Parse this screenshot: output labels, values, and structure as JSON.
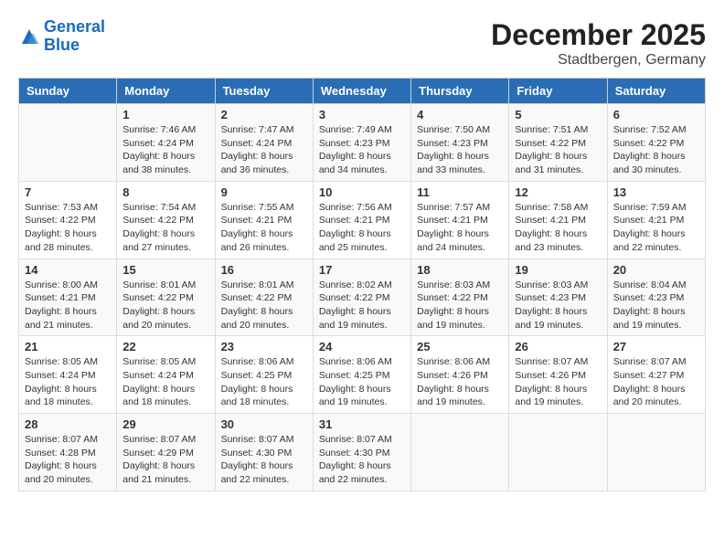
{
  "header": {
    "logo_line1": "General",
    "logo_line2": "Blue",
    "month_year": "December 2025",
    "location": "Stadtbergen, Germany"
  },
  "days_of_week": [
    "Sunday",
    "Monday",
    "Tuesday",
    "Wednesday",
    "Thursday",
    "Friday",
    "Saturday"
  ],
  "weeks": [
    [
      {
        "day": "",
        "info": ""
      },
      {
        "day": "1",
        "info": "Sunrise: 7:46 AM\nSunset: 4:24 PM\nDaylight: 8 hours\nand 38 minutes."
      },
      {
        "day": "2",
        "info": "Sunrise: 7:47 AM\nSunset: 4:24 PM\nDaylight: 8 hours\nand 36 minutes."
      },
      {
        "day": "3",
        "info": "Sunrise: 7:49 AM\nSunset: 4:23 PM\nDaylight: 8 hours\nand 34 minutes."
      },
      {
        "day": "4",
        "info": "Sunrise: 7:50 AM\nSunset: 4:23 PM\nDaylight: 8 hours\nand 33 minutes."
      },
      {
        "day": "5",
        "info": "Sunrise: 7:51 AM\nSunset: 4:22 PM\nDaylight: 8 hours\nand 31 minutes."
      },
      {
        "day": "6",
        "info": "Sunrise: 7:52 AM\nSunset: 4:22 PM\nDaylight: 8 hours\nand 30 minutes."
      }
    ],
    [
      {
        "day": "7",
        "info": "Sunrise: 7:53 AM\nSunset: 4:22 PM\nDaylight: 8 hours\nand 28 minutes."
      },
      {
        "day": "8",
        "info": "Sunrise: 7:54 AM\nSunset: 4:22 PM\nDaylight: 8 hours\nand 27 minutes."
      },
      {
        "day": "9",
        "info": "Sunrise: 7:55 AM\nSunset: 4:21 PM\nDaylight: 8 hours\nand 26 minutes."
      },
      {
        "day": "10",
        "info": "Sunrise: 7:56 AM\nSunset: 4:21 PM\nDaylight: 8 hours\nand 25 minutes."
      },
      {
        "day": "11",
        "info": "Sunrise: 7:57 AM\nSunset: 4:21 PM\nDaylight: 8 hours\nand 24 minutes."
      },
      {
        "day": "12",
        "info": "Sunrise: 7:58 AM\nSunset: 4:21 PM\nDaylight: 8 hours\nand 23 minutes."
      },
      {
        "day": "13",
        "info": "Sunrise: 7:59 AM\nSunset: 4:21 PM\nDaylight: 8 hours\nand 22 minutes."
      }
    ],
    [
      {
        "day": "14",
        "info": "Sunrise: 8:00 AM\nSunset: 4:21 PM\nDaylight: 8 hours\nand 21 minutes."
      },
      {
        "day": "15",
        "info": "Sunrise: 8:01 AM\nSunset: 4:22 PM\nDaylight: 8 hours\nand 20 minutes."
      },
      {
        "day": "16",
        "info": "Sunrise: 8:01 AM\nSunset: 4:22 PM\nDaylight: 8 hours\nand 20 minutes."
      },
      {
        "day": "17",
        "info": "Sunrise: 8:02 AM\nSunset: 4:22 PM\nDaylight: 8 hours\nand 19 minutes."
      },
      {
        "day": "18",
        "info": "Sunrise: 8:03 AM\nSunset: 4:22 PM\nDaylight: 8 hours\nand 19 minutes."
      },
      {
        "day": "19",
        "info": "Sunrise: 8:03 AM\nSunset: 4:23 PM\nDaylight: 8 hours\nand 19 minutes."
      },
      {
        "day": "20",
        "info": "Sunrise: 8:04 AM\nSunset: 4:23 PM\nDaylight: 8 hours\nand 19 minutes."
      }
    ],
    [
      {
        "day": "21",
        "info": "Sunrise: 8:05 AM\nSunset: 4:24 PM\nDaylight: 8 hours\nand 18 minutes."
      },
      {
        "day": "22",
        "info": "Sunrise: 8:05 AM\nSunset: 4:24 PM\nDaylight: 8 hours\nand 18 minutes."
      },
      {
        "day": "23",
        "info": "Sunrise: 8:06 AM\nSunset: 4:25 PM\nDaylight: 8 hours\nand 18 minutes."
      },
      {
        "day": "24",
        "info": "Sunrise: 8:06 AM\nSunset: 4:25 PM\nDaylight: 8 hours\nand 19 minutes."
      },
      {
        "day": "25",
        "info": "Sunrise: 8:06 AM\nSunset: 4:26 PM\nDaylight: 8 hours\nand 19 minutes."
      },
      {
        "day": "26",
        "info": "Sunrise: 8:07 AM\nSunset: 4:26 PM\nDaylight: 8 hours\nand 19 minutes."
      },
      {
        "day": "27",
        "info": "Sunrise: 8:07 AM\nSunset: 4:27 PM\nDaylight: 8 hours\nand 20 minutes."
      }
    ],
    [
      {
        "day": "28",
        "info": "Sunrise: 8:07 AM\nSunset: 4:28 PM\nDaylight: 8 hours\nand 20 minutes."
      },
      {
        "day": "29",
        "info": "Sunrise: 8:07 AM\nSunset: 4:29 PM\nDaylight: 8 hours\nand 21 minutes."
      },
      {
        "day": "30",
        "info": "Sunrise: 8:07 AM\nSunset: 4:30 PM\nDaylight: 8 hours\nand 22 minutes."
      },
      {
        "day": "31",
        "info": "Sunrise: 8:07 AM\nSunset: 4:30 PM\nDaylight: 8 hours\nand 22 minutes."
      },
      {
        "day": "",
        "info": ""
      },
      {
        "day": "",
        "info": ""
      },
      {
        "day": "",
        "info": ""
      }
    ]
  ]
}
